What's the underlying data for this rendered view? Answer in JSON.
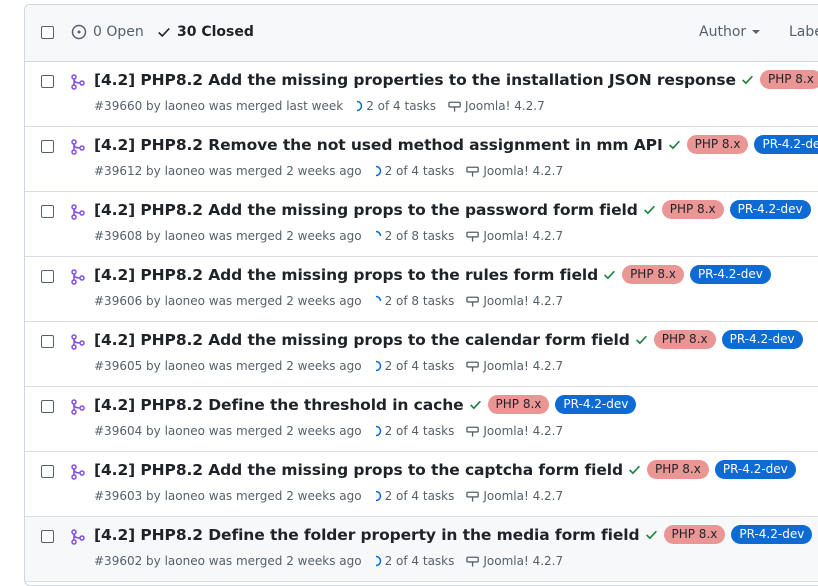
{
  "header": {
    "open_label": "0 Open",
    "closed_label": "30 Closed",
    "author_label": "Author",
    "label_label": "Labe"
  },
  "labels": {
    "php": "PHP 8.x",
    "pr": "PR-4.2-dev"
  },
  "colors": {
    "merged": "#8250df",
    "success": "#1a7f37",
    "php_label": "#e99695",
    "pr_label": "#0e6bd4"
  },
  "rows": [
    {
      "title": "[4.2] PHP8.2 Add the missing properties to the installation JSON response",
      "meta": "#39660 by laoneo was merged last week",
      "tasks": "2 of 4 tasks",
      "task_progress": 0.5,
      "milestone": "Joomla! 4.2.7"
    },
    {
      "title": "[4.2] PHP8.2 Remove the not used method assignment in mm API",
      "meta": "#39612 by laoneo was merged 2 weeks ago",
      "tasks": "2 of 4 tasks",
      "task_progress": 0.5,
      "milestone": "Joomla! 4.2.7"
    },
    {
      "title": "[4.2] PHP8.2 Add the missing props to the password form field",
      "meta": "#39608 by laoneo was merged 2 weeks ago",
      "tasks": "2 of 8 tasks",
      "task_progress": 0.25,
      "milestone": "Joomla! 4.2.7"
    },
    {
      "title": "[4.2] PHP8.2 Add the missing props to the rules form field",
      "meta": "#39606 by laoneo was merged 2 weeks ago",
      "tasks": "2 of 8 tasks",
      "task_progress": 0.25,
      "milestone": "Joomla! 4.2.7"
    },
    {
      "title": "[4.2] PHP8.2 Add the missing props to the calendar form field",
      "meta": "#39605 by laoneo was merged 2 weeks ago",
      "tasks": "2 of 4 tasks",
      "task_progress": 0.5,
      "milestone": "Joomla! 4.2.7"
    },
    {
      "title": "[4.2] PHP8.2 Define the threshold in cache",
      "meta": "#39604 by laoneo was merged 2 weeks ago",
      "tasks": "2 of 4 tasks",
      "task_progress": 0.5,
      "milestone": "Joomla! 4.2.7"
    },
    {
      "title": "[4.2] PHP8.2 Add the missing props to the captcha form field",
      "meta": "#39603 by laoneo was merged 2 weeks ago",
      "tasks": "2 of 4 tasks",
      "task_progress": 0.5,
      "milestone": "Joomla! 4.2.7"
    },
    {
      "title": "[4.2] PHP8.2 Define the folder property in the media form field",
      "meta": "#39602 by laoneo was merged 2 weeks ago",
      "tasks": "2 of 4 tasks",
      "task_progress": 0.5,
      "milestone": "Joomla! 4.2.7"
    }
  ]
}
